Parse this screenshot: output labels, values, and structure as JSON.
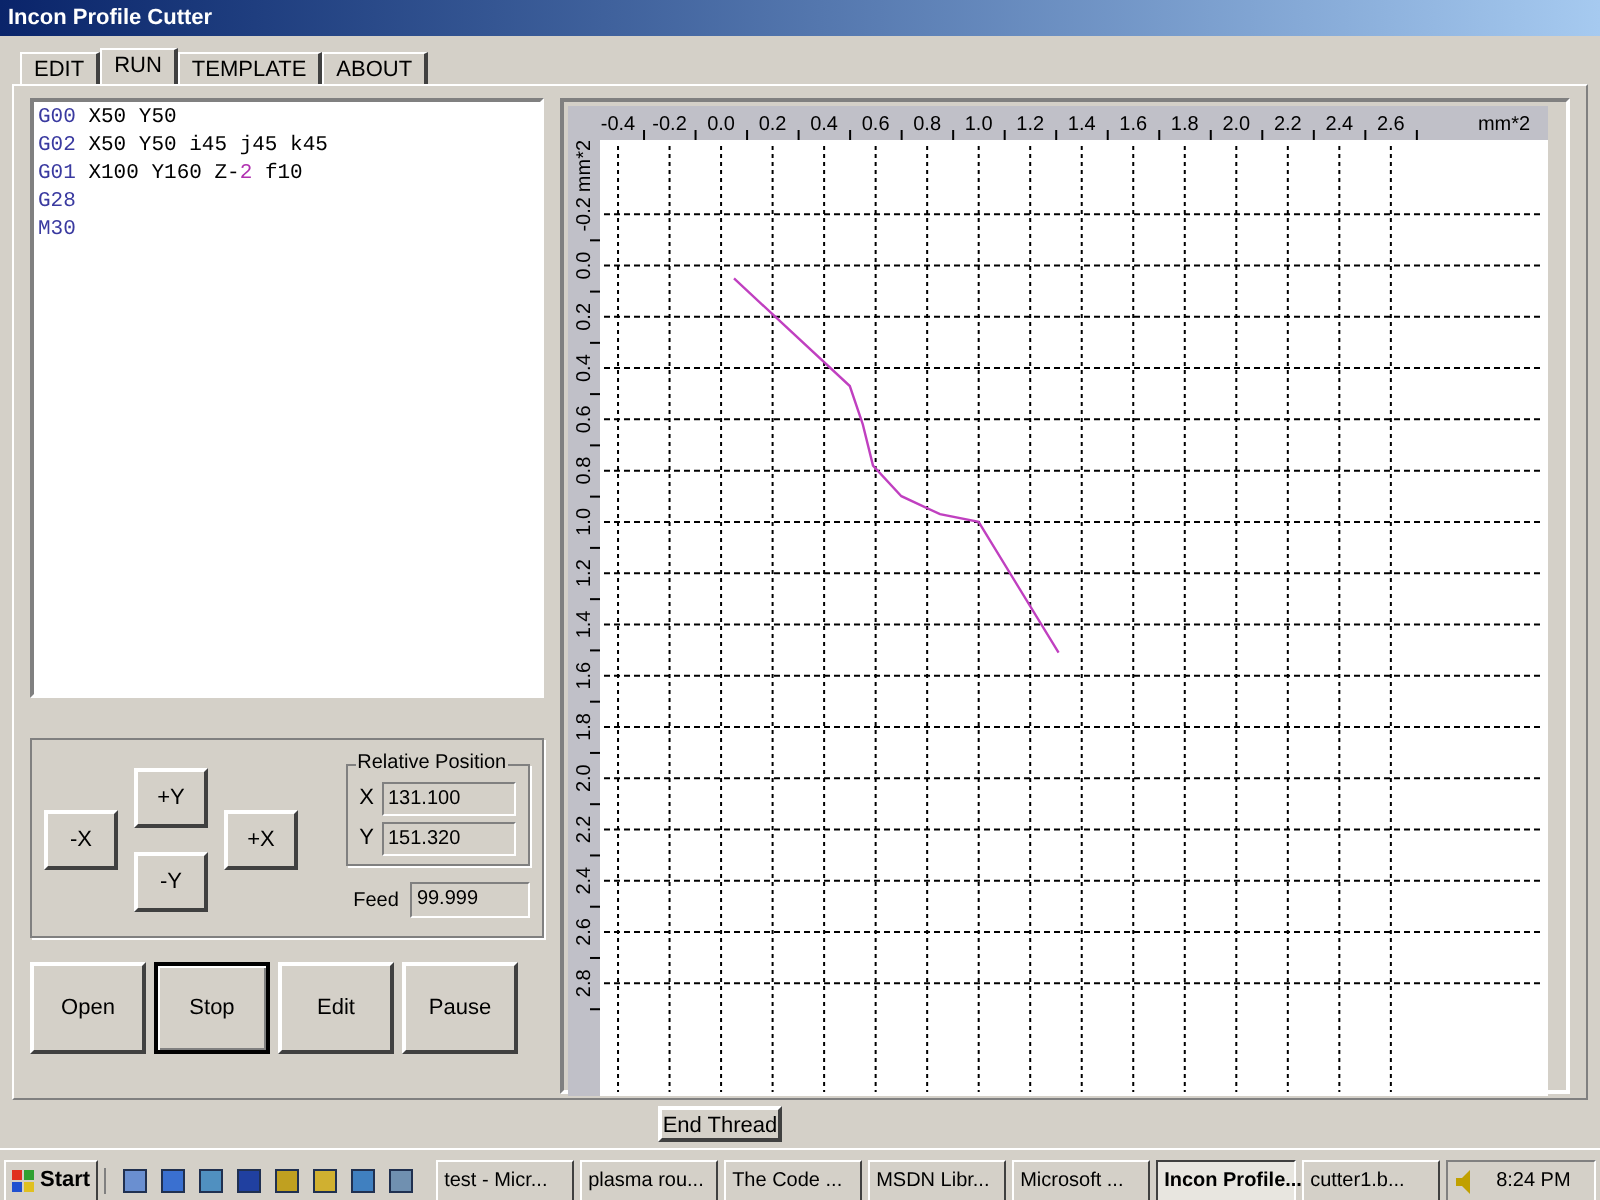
{
  "window": {
    "title": "Incon Profile Cutter"
  },
  "tabs": [
    {
      "label": "EDIT",
      "selected": false
    },
    {
      "label": "RUN",
      "selected": true
    },
    {
      "label": "TEMPLATE",
      "selected": false
    },
    {
      "label": "ABOUT",
      "selected": false
    }
  ],
  "code_lines": [
    [
      {
        "kind": "keyword",
        "text": "G00"
      },
      {
        "kind": "plain",
        "text": " X50 Y50"
      }
    ],
    [
      {
        "kind": "keyword",
        "text": "G02"
      },
      {
        "kind": "plain",
        "text": " X50 Y50 i45 j45 k45"
      }
    ],
    [
      {
        "kind": "keyword",
        "text": "G01"
      },
      {
        "kind": "plain",
        "text": " X100 Y160 Z-"
      },
      {
        "kind": "number",
        "text": "2"
      },
      {
        "kind": "plain",
        "text": " f10"
      }
    ],
    [
      {
        "kind": "keyword",
        "text": "G28"
      }
    ],
    [
      {
        "kind": "keyword",
        "text": "M30"
      }
    ]
  ],
  "jog_buttons": {
    "minus_x": "-X",
    "plus_y": "+Y",
    "minus_y": "-Y",
    "plus_x": "+X"
  },
  "relative_position": {
    "title": "Relative Position",
    "x_label": "X",
    "x_value": "131.100",
    "y_label": "Y",
    "y_value": "151.320"
  },
  "feed": {
    "label": "Feed",
    "value": "99.999"
  },
  "action_buttons": [
    {
      "label": "Open",
      "selected": false
    },
    {
      "label": "Stop",
      "selected": true
    },
    {
      "label": "Edit",
      "selected": false
    },
    {
      "label": "Pause",
      "selected": false
    }
  ],
  "plot": {
    "chart_data": {
      "type": "line",
      "xlabel": "mm*2",
      "ylabel": "mm*2",
      "x": [
        0.05,
        0.5,
        0.55,
        0.59,
        0.7,
        0.85,
        1.0,
        1.31
      ],
      "series": [
        {
          "color": "#c040c0",
          "values": [
            0.05,
            0.47,
            0.62,
            0.78,
            0.9,
            0.97,
            1.0,
            1.51
          ]
        }
      ],
      "grid": true,
      "xlim": [
        -0.47,
        3.21
      ],
      "ylim": [
        3.24,
        -0.49
      ],
      "xticks": [
        {
          "value": -0.4,
          "label": "-0.4"
        },
        {
          "value": -0.2,
          "label": "-0.2"
        },
        {
          "value": 0,
          "label": "0.0"
        },
        {
          "value": 0.2,
          "label": "0.2"
        },
        {
          "value": 0.4,
          "label": "0.4"
        },
        {
          "value": 0.6,
          "label": "0.6"
        },
        {
          "value": 0.8,
          "label": "0.8"
        },
        {
          "value": 1,
          "label": "1.0"
        },
        {
          "value": 1.2,
          "label": "1.2"
        },
        {
          "value": 1.4,
          "label": "1.4"
        },
        {
          "value": 1.6,
          "label": "1.6"
        },
        {
          "value": 1.8,
          "label": "1.8"
        },
        {
          "value": 2,
          "label": "2.0"
        },
        {
          "value": 2.2,
          "label": "2.2"
        },
        {
          "value": 2.4,
          "label": "2.4"
        },
        {
          "value": 2.6,
          "label": "2.6"
        }
      ],
      "yticks": [
        {
          "value": -0.2,
          "label": "-0.2"
        },
        {
          "value": 0,
          "label": "0.0"
        },
        {
          "value": 0.2,
          "label": "0.2"
        },
        {
          "value": 0.4,
          "label": "0.4"
        },
        {
          "value": 0.6,
          "label": "0.6"
        },
        {
          "value": 0.8,
          "label": "0.8"
        },
        {
          "value": 1,
          "label": "1.0"
        },
        {
          "value": 1.2,
          "label": "1.2"
        },
        {
          "value": 1.4,
          "label": "1.4"
        },
        {
          "value": 1.6,
          "label": "1.6"
        },
        {
          "value": 1.8,
          "label": "1.8"
        },
        {
          "value": 2,
          "label": "2.0"
        },
        {
          "value": 2.2,
          "label": "2.2"
        },
        {
          "value": 2.4,
          "label": "2.4"
        },
        {
          "value": 2.6,
          "label": "2.6"
        },
        {
          "value": 2.8,
          "label": "2.8"
        }
      ]
    }
  },
  "end_thread_button": "End Thread",
  "taskbar": {
    "start": "Start",
    "tasks": [
      {
        "label": "test - Micr...",
        "selected": false
      },
      {
        "label": "plasma rou...",
        "selected": false
      },
      {
        "label": "The Code ...",
        "selected": false
      },
      {
        "label": "MSDN Libr...",
        "selected": false
      },
      {
        "label": "Microsoft ...",
        "selected": false
      },
      {
        "label": "Incon Profile...",
        "selected": true
      },
      {
        "label": "cutter1.b...",
        "selected": false
      }
    ],
    "clock": "8:24 PM"
  }
}
